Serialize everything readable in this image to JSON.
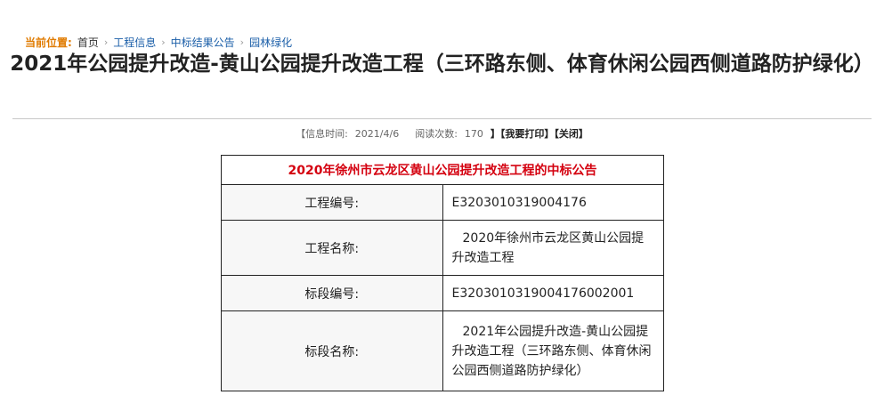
{
  "breadcrumb": {
    "prefix": "当前位置:",
    "items": [
      "首页",
      "工程信息",
      "中标结果公告",
      "园林绿化"
    ]
  },
  "article": {
    "title": "2021年公园提升改造-黄山公园提升改造工程（三环路东侧、体育休闲公园西侧道路防护绿化）",
    "info_time_label": "【信息时间:",
    "info_time_value": "2021/4/6",
    "read_count_label": "阅读次数:",
    "read_count_value": "170",
    "print_link": "】【我要打印】",
    "close_link": "【关闭】"
  },
  "notice_table": {
    "heading": "2020年徐州市云龙区黄山公园提升改造工程的中标公告",
    "rows": [
      {
        "label": "工程编号:",
        "value": "E3203010319004176"
      },
      {
        "label": "工程名称:",
        "value": "2020年徐州市云龙区黄山公园提升改造工程"
      },
      {
        "label": "标段编号:",
        "value": "E3203010319004176002001"
      },
      {
        "label": "标段名称:",
        "value": "2021年公园提升改造-黄山公园提升改造工程（三环路东侧、体育休闲公园西侧道路防护绿化）"
      }
    ]
  },
  "colors": {
    "breadcrumb_prefix": "#e07b00",
    "link": "#1a5ea8",
    "table_heading": "#d4000f"
  },
  "icons": {
    "breadcrumb_separator": "chevron-right-icon"
  }
}
